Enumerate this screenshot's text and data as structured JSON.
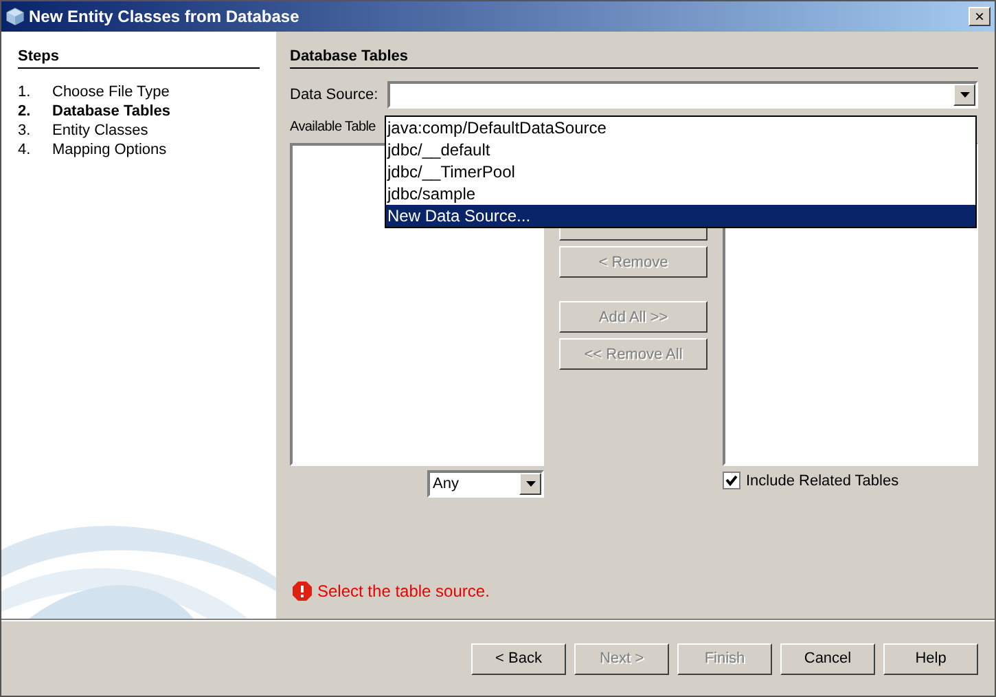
{
  "window": {
    "title": "New Entity Classes from Database",
    "close": "×"
  },
  "steps": {
    "title": "Steps",
    "items": [
      {
        "number": "1.",
        "label": "Choose File Type",
        "selected": false
      },
      {
        "number": "2.",
        "label": "Database Tables",
        "selected": true
      },
      {
        "number": "3.",
        "label": "Entity Classes",
        "selected": false
      },
      {
        "number": "4.",
        "label": "Mapping Options",
        "selected": false
      }
    ]
  },
  "panel": {
    "title": "Database Tables",
    "data_source_label": "Data Source:",
    "data_source_options": [
      {
        "label": "java:comp/DefaultDataSource",
        "selected": false
      },
      {
        "label": "jdbc/__default",
        "selected": false
      },
      {
        "label": "jdbc/__TimerPool",
        "selected": false
      },
      {
        "label": "jdbc/sample",
        "selected": false
      },
      {
        "label": "New Data Source...",
        "selected": true
      }
    ],
    "available_label": "Available Table",
    "filter": "Any",
    "move_buttons": [
      {
        "label": "< Remove",
        "disabled": true
      },
      {
        "label": "Add All >>",
        "disabled": true
      },
      {
        "label": "<< Remove All",
        "disabled": true
      }
    ],
    "include_related": {
      "label": "Include Related Tables",
      "checked": true
    },
    "error": "Select the table source."
  },
  "buttons": [
    {
      "label": "< Back",
      "disabled": false
    },
    {
      "label": "Next >",
      "disabled": true
    },
    {
      "label": "Finish",
      "disabled": true
    },
    {
      "label": "Cancel",
      "disabled": false
    },
    {
      "label": "Help",
      "disabled": false
    }
  ]
}
